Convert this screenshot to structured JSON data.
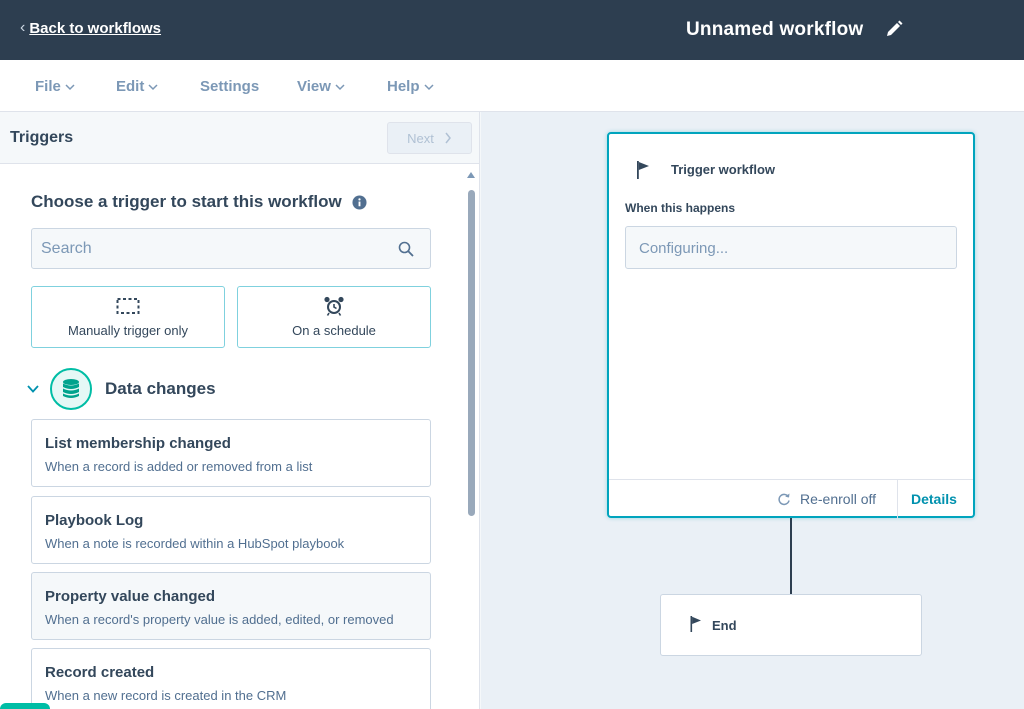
{
  "header": {
    "back_label": "Back to workflows",
    "workflow_title": "Unnamed workflow",
    "edit_icon": "pencil-icon"
  },
  "menu": {
    "file": "File",
    "edit": "Edit",
    "settings": "Settings",
    "view": "View",
    "help": "Help"
  },
  "panel": {
    "title": "Triggers",
    "next_label": "Next",
    "choose_title": "Choose a trigger to start this workflow",
    "search_placeholder": "Search",
    "quick_triggers": [
      {
        "label": "Manually trigger only",
        "icon": "dashed-box-icon"
      },
      {
        "label": "On a schedule",
        "icon": "alarm-clock-icon"
      }
    ],
    "section": {
      "label": "Data changes",
      "icon": "database-icon"
    },
    "cards": [
      {
        "title": "List membership changed",
        "desc": "When a record is added or removed from a list"
      },
      {
        "title": "Playbook Log",
        "desc": "When a note is recorded within a HubSpot playbook"
      },
      {
        "title": "Property value changed",
        "desc": "When a record's property value is added, edited, or removed"
      },
      {
        "title": "Record created",
        "desc": "When a new record is created in the CRM"
      }
    ]
  },
  "canvas": {
    "trigger_title": "Trigger workflow",
    "when_label": "When this happens",
    "configuring": "Configuring...",
    "reenroll": "Re-enroll off",
    "details": "Details",
    "end_label": "End"
  },
  "colors": {
    "header_bg": "#2d3e50",
    "accent_teal": "#00a4bd",
    "link_blue": "#0091ae",
    "green": "#00bda5"
  }
}
